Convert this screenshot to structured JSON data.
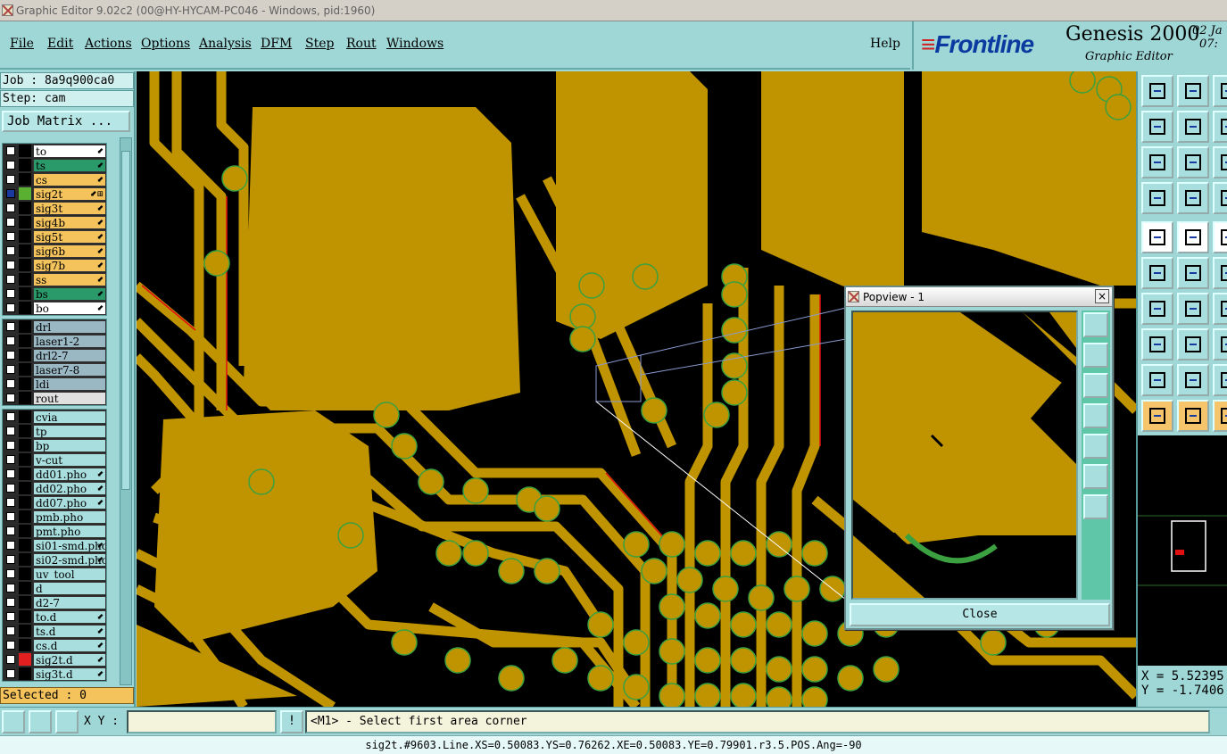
{
  "window": {
    "title": "Graphic Editor 9.02c2 (00@HY-HYCAM-PC046 - Windows, pid:1960)"
  },
  "menu": {
    "items": [
      {
        "label": "File"
      },
      {
        "label": "Edit"
      },
      {
        "label": "Actions"
      },
      {
        "label": "Options"
      },
      {
        "label": "Analysis"
      },
      {
        "label": "DFM"
      },
      {
        "label": "Step"
      },
      {
        "label": "Rout"
      },
      {
        "label": "Windows"
      }
    ],
    "help": "Help"
  },
  "brand": {
    "logo": "Frontline",
    "product": "Genesis 2000",
    "subtitle": "Graphic Editor",
    "date": "02 Ja",
    "time": "07:"
  },
  "job": {
    "job_text": "Job : 8a9q900ca0",
    "step_text": "Step: cam",
    "matrix_button": "Job Matrix ..."
  },
  "layers": {
    "board": [
      {
        "name": "to",
        "color": "#ffffff",
        "swatch": "#000000",
        "flag": "⬋"
      },
      {
        "name": "ts",
        "color": "#2a9a6a",
        "swatch": "#000000",
        "flag": "⬋"
      },
      {
        "name": "cs",
        "color": "#f4c35c",
        "swatch": "#000000",
        "flag": "⬋"
      },
      {
        "name": "sig2t",
        "color": "#f4c35c",
        "swatch": "#5ab030",
        "flag": "⬋⊞",
        "active": true
      },
      {
        "name": "sig3t",
        "color": "#f4c35c",
        "swatch": "#000000",
        "flag": "⬋"
      },
      {
        "name": "sig4b",
        "color": "#f4c35c",
        "swatch": "#000000",
        "flag": "⬋"
      },
      {
        "name": "sig5t",
        "color": "#f4c35c",
        "swatch": "#000000",
        "flag": "⬋"
      },
      {
        "name": "sig6b",
        "color": "#f4c35c",
        "swatch": "#000000",
        "flag": "⬋"
      },
      {
        "name": "sig7b",
        "color": "#f4c35c",
        "swatch": "#000000",
        "flag": "⬋"
      },
      {
        "name": "ss",
        "color": "#f4c35c",
        "swatch": "#000000",
        "flag": "⬋"
      },
      {
        "name": "bs",
        "color": "#2a9a6a",
        "swatch": "#000000",
        "flag": "⬋"
      },
      {
        "name": "bo",
        "color": "#ffffff",
        "swatch": "#000000",
        "flag": "⬋"
      }
    ],
    "drill": [
      {
        "name": "drl",
        "color": "#9ab8c4",
        "swatch": "#000000",
        "flag": ""
      },
      {
        "name": "laser1-2",
        "color": "#9ab8c4",
        "swatch": "#000000",
        "flag": ""
      },
      {
        "name": "drl2-7",
        "color": "#9ab8c4",
        "swatch": "#000000",
        "flag": ""
      },
      {
        "name": "laser7-8",
        "color": "#9ab8c4",
        "swatch": "#000000",
        "flag": ""
      },
      {
        "name": "ldi",
        "color": "#9ab8c4",
        "swatch": "#000000",
        "flag": ""
      },
      {
        "name": "rout",
        "color": "#e0e0e0",
        "swatch": "#000000",
        "flag": ""
      }
    ],
    "misc": [
      {
        "name": "cvia",
        "color": "#a8dede",
        "swatch": "#000000",
        "flag": ""
      },
      {
        "name": "tp",
        "color": "#a8dede",
        "swatch": "#000000",
        "flag": ""
      },
      {
        "name": "bp",
        "color": "#a8dede",
        "swatch": "#000000",
        "flag": ""
      },
      {
        "name": "v-cut",
        "color": "#a8dede",
        "swatch": "#000000",
        "flag": ""
      },
      {
        "name": "dd01.pho",
        "color": "#a8dede",
        "swatch": "#000000",
        "flag": "⬋"
      },
      {
        "name": "dd02.pho",
        "color": "#a8dede",
        "swatch": "#000000",
        "flag": "⬋"
      },
      {
        "name": "dd07.pho",
        "color": "#a8dede",
        "swatch": "#000000",
        "flag": "⬋"
      },
      {
        "name": "pmb.pho",
        "color": "#a8dede",
        "swatch": "#000000",
        "flag": ""
      },
      {
        "name": "pmt.pho",
        "color": "#a8dede",
        "swatch": "#000000",
        "flag": ""
      },
      {
        "name": "si01-smd.pho",
        "color": "#a8dede",
        "swatch": "#000000",
        "flag": "⬋"
      },
      {
        "name": "si02-smd.pho",
        "color": "#a8dede",
        "swatch": "#000000",
        "flag": "⬋"
      },
      {
        "name": "uv_tool",
        "color": "#a8dede",
        "swatch": "#000000",
        "flag": ""
      },
      {
        "name": "d",
        "color": "#a8dede",
        "swatch": "#000000",
        "flag": ""
      },
      {
        "name": "d2-7",
        "color": "#a8dede",
        "swatch": "#000000",
        "flag": ""
      },
      {
        "name": "to.d",
        "color": "#a8dede",
        "swatch": "#000000",
        "flag": "⬋"
      },
      {
        "name": "ts.d",
        "color": "#a8dede",
        "swatch": "#000000",
        "flag": "⬋"
      },
      {
        "name": "cs.d",
        "color": "#a8dede",
        "swatch": "#000000",
        "flag": "⬋"
      },
      {
        "name": "sig2t.d",
        "color": "#a8dede",
        "swatch": "#e02020",
        "flag": "⬋"
      },
      {
        "name": "sig3t.d",
        "color": "#a8dede",
        "swatch": "#000000",
        "flag": "⬋"
      }
    ]
  },
  "selected_text": "Selected : 0",
  "colors": {
    "copper": "#bf9400",
    "background": "#000000",
    "highlight_red": "#e01010",
    "pad_green": "#3aa040"
  },
  "popview": {
    "title": "Popview - 1",
    "close_label": "Close",
    "close_x": "×"
  },
  "coords": {
    "x_text": "X = 5.52395",
    "y_text": "Y = -1.7406"
  },
  "bottom": {
    "xy_label": "X Y :",
    "xy_value": "",
    "excl": "!",
    "message": "<M1> - Select first area corner",
    "status": "sig2t.#9603.Line.XS=0.50083.YS=0.76262.XE=0.50083.YE=0.79901.r3.5.POS.Ang=-90"
  }
}
